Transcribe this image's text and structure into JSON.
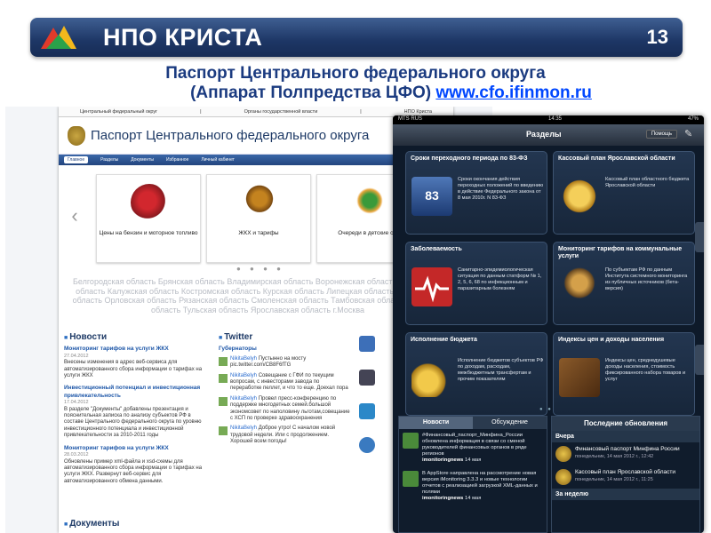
{
  "header": {
    "brand": "НПО КРИСТА",
    "slide_number": "13"
  },
  "title": {
    "line1": "Паспорт Центрального федерального округа",
    "line2_prefix": "(Аппарат Полпредства ЦФО) ",
    "line2_link": "www.cfo.ifinmon.ru"
  },
  "site": {
    "topnav": [
      "Центральный федеральный округ",
      "|",
      "Органы государственной власти",
      "|",
      "НПО Криста"
    ],
    "site_title": "Паспорт Центрального федерального округа",
    "menu": [
      "Главное",
      "Разделы",
      "Документы",
      "Избранное",
      "Личный кабинет"
    ],
    "cards": [
      "Цены на бензин и моторное топливо",
      "ЖКХ и тарифы",
      "Очереди в детские сад"
    ],
    "regions": "Белгородская область Брянская область Владимирская область Воронежская область Ивановская область Калужская область Костромская область Курская область Липецкая область Московская область Орловская область Рязанская область Смоленская область Тамбовская область Тверская область Тульская область Ярославская область г.Москва",
    "news_title": "Новости",
    "news": [
      {
        "title": "Мониторинг тарифов на услуги ЖКХ",
        "date": "27.04.2012",
        "text": "Внесены изменения в адрес веб-сервиса для автоматизированного сбора информации о тарифах на услуги ЖКХ"
      },
      {
        "title": "Инвестиционный потенциал и инвестиционная привлекательность",
        "date": "17.04.2012",
        "text": "В разделе \"Документы\" добавлены презентация и пояснительная записка по анализу субъектов РФ в составе Центрального федерального округа по уровню инвестиционного потенциала и инвестиционной привлекательности за 2010-2011 годы"
      },
      {
        "title": "Мониторинг тарифов на услуги ЖКХ",
        "date": "28.03.2012",
        "text": "Обновлены пример xml-файла и xsd-схемы для автоматизированного сбора информации о тарифах на услуги ЖКХ. Развернут веб-сервис для автоматизированного обмена данными."
      }
    ],
    "twitter_title": "Twitter",
    "twitter_sub": "Губернаторы",
    "tweets": [
      {
        "user": "NikitaBelyh",
        "text": "Пустынно на мосту pic.twitter.com/CB8F6fTG"
      },
      {
        "user": "NikitaBelyh",
        "text": "Совещание с ГФИ по текущим вопросам, с инвесторами завода по переработке пеллет, и что то еще. Доехал пора"
      },
      {
        "user": "NikitaBelyh",
        "text": "Провел пресс-конференцию по поддержке многодетных семей.большой экономсовет по наполовину льготам,совещание с ХСП по проверке здравоохранения"
      },
      {
        "user": "NikitaBelyh",
        "text": "Доброе утро! С началом новой трудовой недели. Или с продолжением. Хорошей всем погоды!"
      }
    ],
    "documents_title": "Документы"
  },
  "ipad": {
    "carrier": "MTS RUS",
    "time": "14:35",
    "battery": "47%",
    "nav_title": "Разделы",
    "help": "Помощь",
    "tiles": [
      {
        "title": "Сроки переходного периода по 83-ФЗ",
        "text": "Сроки окончания действия переходных положений по введению в действие Федерального закона от 8 мая 2010г. N 83-ФЗ",
        "icon": "law-83-icon",
        "color": "#2b4d8a"
      },
      {
        "title": "Кассовый план Ярославской области",
        "text": "Кассовый план областного бюджета Ярославской области",
        "icon": "gold-coin-icon",
        "color": "#c9962b"
      },
      {
        "title": "Заболеваемость",
        "text": "Санитарно-эпидемиологическая ситуация по данным статформ № 1, 2, 5, 6, 68 по инфекционным и паразитарным болезням",
        "icon": "heartbeat-icon",
        "color": "#c42828"
      },
      {
        "title": "Мониторинг тарифов на коммунальные услуги",
        "text": "По субъектам РФ по данным Института системного мониторинга из публичных источников (бета-версия)",
        "icon": "faucet-icon",
        "color": "#8a7a5a"
      },
      {
        "title": "Исполнение бюджета",
        "text": "Исполнение бюджетов субъектов РФ по доходам, расходам, межбюджетным трансфертам и прочим показателям",
        "icon": "coins-stack-icon",
        "color": "#d8a62a"
      },
      {
        "title": "Индексы цен и доходы населения",
        "text": "Индексы цен, среднедушевые доходы населения, стоимость фиксированного набора товаров и услуг",
        "icon": "wallet-icon",
        "color": "#7a4a22"
      }
    ],
    "segments": [
      "Новости",
      "Обсуждение"
    ],
    "left_news": [
      {
        "text": "#Финансовый_паспорт_Минфина_России обновлена информация в связи со сменой руководителей финансовых органов в ряде регионов",
        "user": "imonitoringnews",
        "when": "14 мая"
      },
      {
        "text": "В AppStore направлена на рассмотрение новая версия iMonitoring 3.3.3 и новые технологии отчетов с реализацией загрузкой XML-данных и полями",
        "user": "imonitoringnews",
        "when": "14 мая"
      }
    ],
    "updates_title": "Последние обновления",
    "yesterday": "Вчера",
    "updates": [
      {
        "title": "Финансовый паспорт Минфина России",
        "when": "понедельник, 14 мая 2012 г., 12:42"
      },
      {
        "title": "Кассовый план Ярославской области",
        "when": "понедельник, 14 мая 2012 г., 11:25"
      }
    ],
    "week": "За неделю"
  }
}
